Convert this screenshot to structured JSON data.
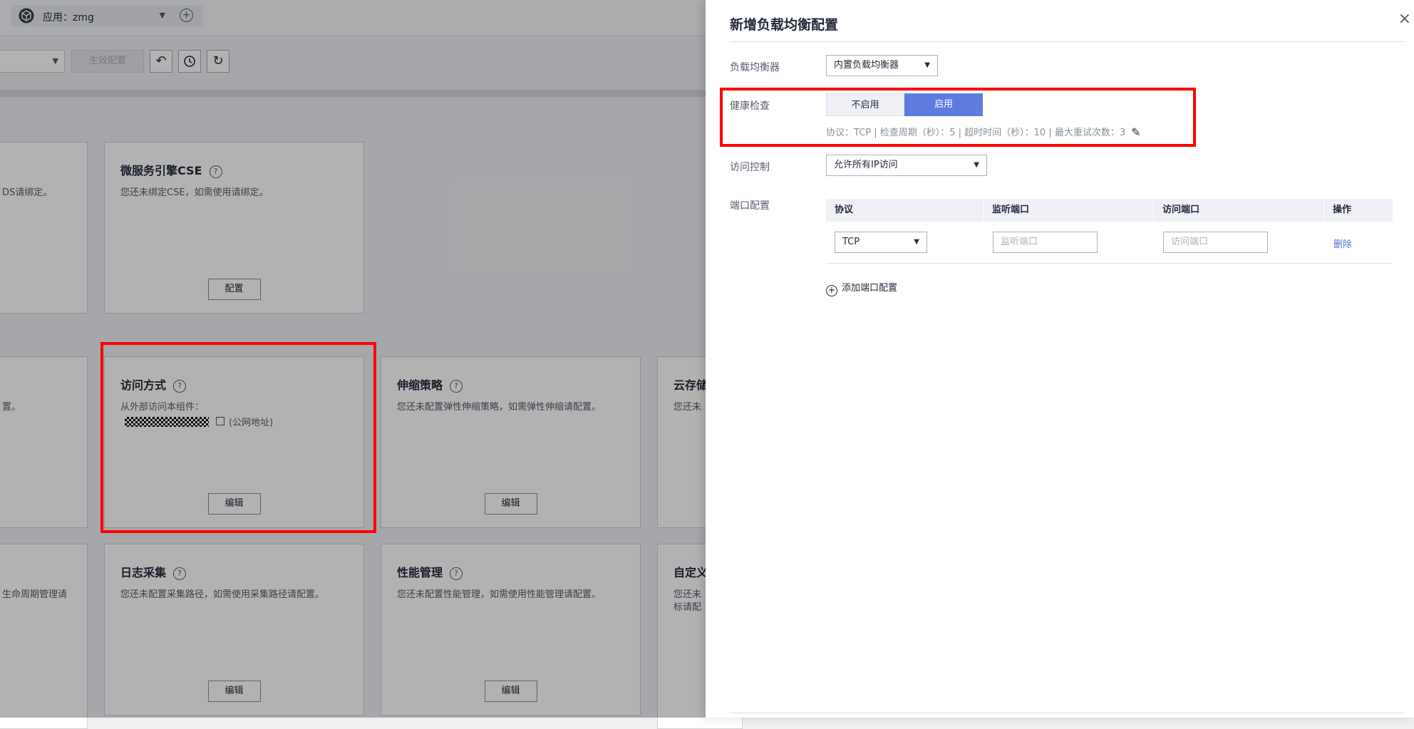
{
  "header": {
    "app_label": "应用：zmg"
  },
  "toolbar": {
    "apply_label": "生效配置"
  },
  "cards": {
    "partial_left_1": {
      "desc": "DS请绑定。"
    },
    "cse": {
      "title": "微服务引擎CSE",
      "desc": "您还未绑定CSE，如需使用请绑定。",
      "button": "配置"
    },
    "partial_left_2": {
      "desc": "置。"
    },
    "access": {
      "title": "访问方式",
      "desc": "从外部访问本组件：",
      "address_note": "(公网地址)",
      "button": "编辑"
    },
    "scaling": {
      "title": "伸缩策略",
      "desc": "您还未配置弹性伸缩策略，如需弹性伸缩请配置。",
      "button": "编辑"
    },
    "storage": {
      "title": "云存储",
      "desc": "您还未"
    },
    "partial_left_3": {
      "desc": "生命周期管理请"
    },
    "log": {
      "title": "日志采集",
      "desc": "您还未配置采集路径，如需使用采集路径请配置。",
      "button": "编辑"
    },
    "perf": {
      "title": "性能管理",
      "desc": "您还未配置性能管理，如需使用性能管理请配置。",
      "button": "编辑"
    },
    "custom": {
      "title": "自定义",
      "desc1": "您还未",
      "desc2": "标请配"
    }
  },
  "drawer": {
    "title": "新增负载均衡配置",
    "close": "×",
    "lb_label": "负载均衡器",
    "lb_value": "内置负载均衡器",
    "hc_label": "健康检查",
    "hc_off": "不启用",
    "hc_on": "启用",
    "hc_info": "协议：TCP | 检查周期（秒）：5 | 超时时间（秒）：10 | 最大重试次数：3",
    "ac_label": "访问控制",
    "ac_value": "允许所有IP访问",
    "port_label": "端口配置",
    "table": {
      "headers": [
        "协议",
        "监听端口",
        "访问端口",
        "操作"
      ],
      "row": {
        "protocol": "TCP",
        "listen_placeholder": "监听端口",
        "access_placeholder": "访问端口",
        "action": "删除"
      }
    },
    "add_port": "添加端口配置"
  }
}
